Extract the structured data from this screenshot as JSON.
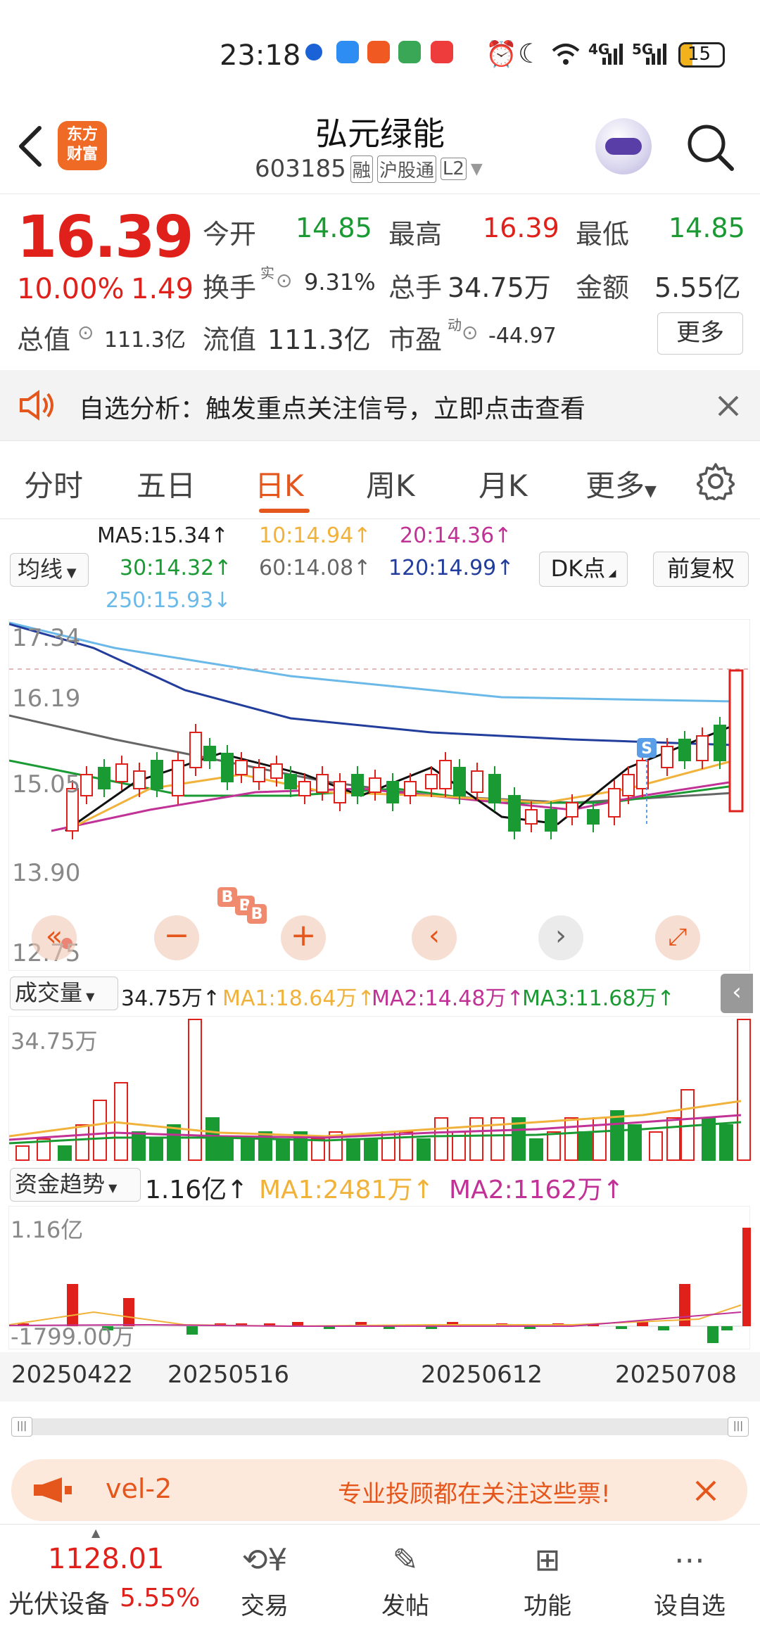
{
  "status_bar": {
    "time": "23:18",
    "network1": "4G",
    "network2": "5G",
    "battery": "15"
  },
  "header": {
    "title": "弘元绿能",
    "code": "603185",
    "tags": [
      "融",
      "沪股通",
      "L2"
    ],
    "logo_line1": "东方",
    "logo_line2": "财富"
  },
  "quote": {
    "price": "16.39",
    "change_pct": "10.00%",
    "change": "1.49",
    "open_label": "今开",
    "open": "14.85",
    "high_label": "最高",
    "high": "16.39",
    "low_label": "最低",
    "low": "14.85",
    "turnover_label": "换手",
    "turnover_sup": "实",
    "turnover": "9.31%",
    "volume_label": "总手",
    "volume": "34.75万",
    "amount_label": "金额",
    "amount": "5.55亿",
    "mktcap_label": "总值",
    "mktcap": "111.3亿",
    "float_label": "流值",
    "float": "111.3亿",
    "pe_label": "市盈",
    "pe_sup": "动",
    "pe": "-44.97",
    "more_label": "更多"
  },
  "banner": {
    "text": "自选分析：触发重点关注信号，立即点击查看"
  },
  "tabs": [
    {
      "label": "分时",
      "active": false
    },
    {
      "label": "五日",
      "active": false
    },
    {
      "label": "日K",
      "active": true
    },
    {
      "label": "周K",
      "active": false
    },
    {
      "label": "月K",
      "active": false
    },
    {
      "label": "更多",
      "active": false
    }
  ],
  "ma_legend": {
    "selector": "均线",
    "ma5": "MA5:15.34↑",
    "ma10": "10:14.94↑",
    "ma20": "20:14.36↑",
    "ma30": "30:14.32↑",
    "ma60": "60:14.08↑",
    "ma120": "120:14.99↑",
    "ma250": "250:15.93↓",
    "dk_button": "DK点",
    "adjust_button": "前复权"
  },
  "price_axis": {
    "p1": "17.34",
    "p2": "16.19",
    "p3": "15.05",
    "p4": "13.90",
    "p5": "12.75"
  },
  "chart_markers": {
    "buy": "B",
    "sell": "S"
  },
  "volume_panel": {
    "selector": "成交量",
    "value": "34.75万↑",
    "ma1": "MA1:18.64万↑",
    "ma2": "MA2:14.48万↑",
    "ma3": "MA3:11.68万↑",
    "axis_top": "34.75万"
  },
  "fund_panel": {
    "selector": "资金趋势",
    "value": "1.16亿↑",
    "ma1": "MA1:2481万↑",
    "ma2": "MA2:1162万↑",
    "axis_top": "1.16亿",
    "axis_bottom": "-1799.00万"
  },
  "dates": [
    "20250422",
    "20250516",
    "20250612",
    "20250708"
  ],
  "promo": {
    "left": "vel-2",
    "text": "专业投顾都在关注这些票!"
  },
  "bottom_bar": {
    "index_value": "1128.01",
    "index_name": "光伏设备",
    "index_pct": "5.55%",
    "items": [
      "交易",
      "发帖",
      "功能",
      "设自选"
    ]
  },
  "colors": {
    "up": "#e0211b",
    "down": "#1a9a32",
    "accent": "#e5561c"
  }
}
